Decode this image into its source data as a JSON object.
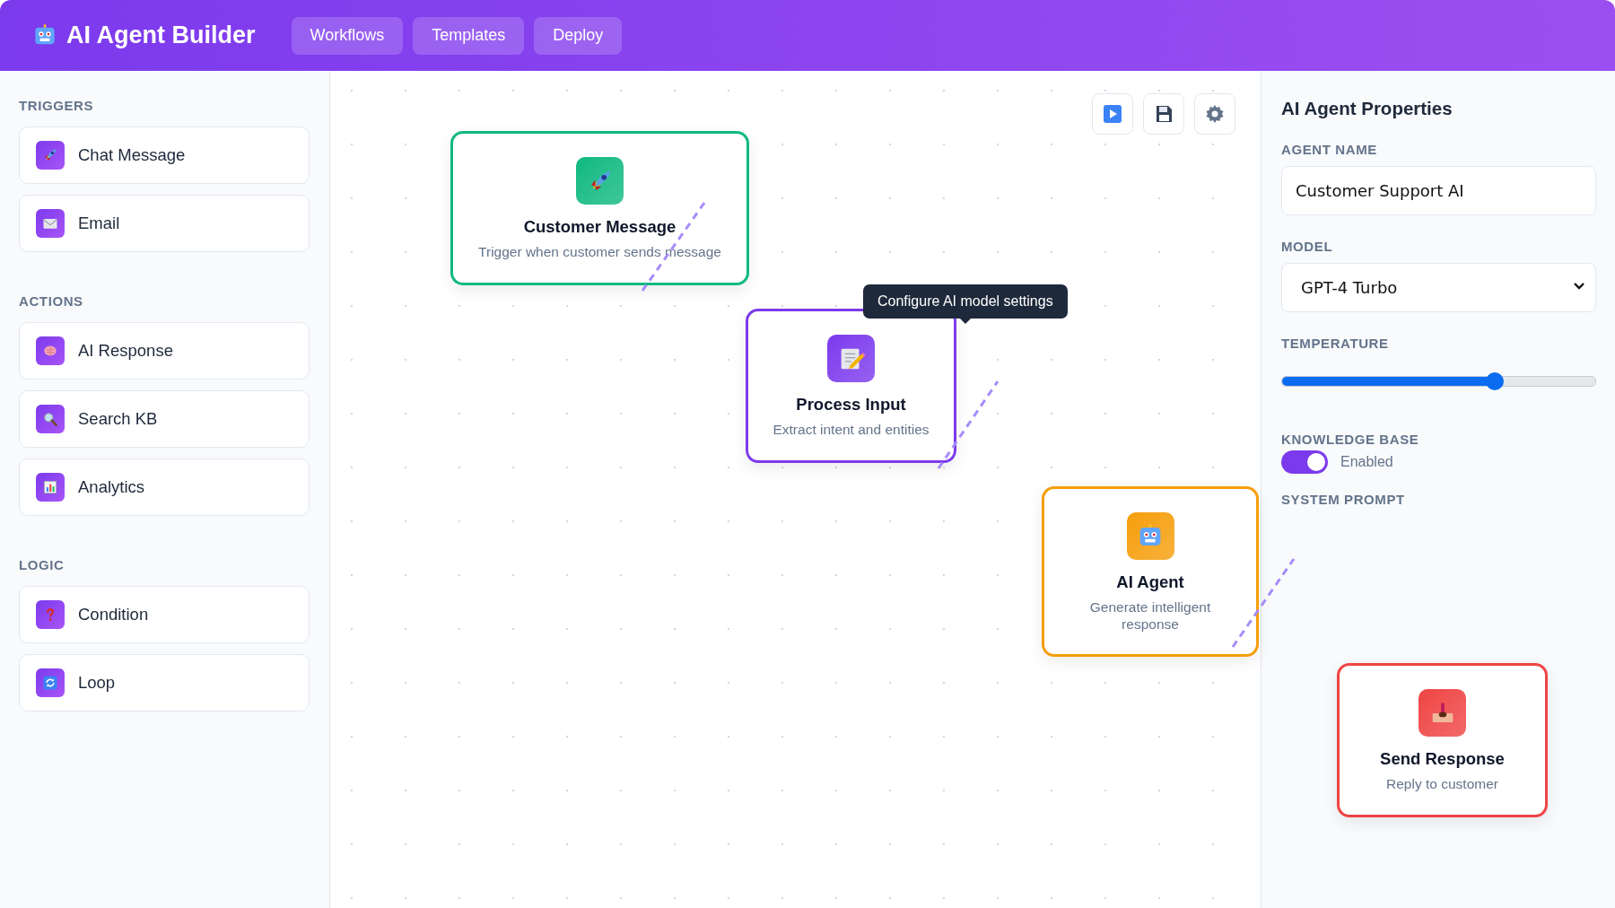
{
  "header": {
    "title": "AI Agent Builder",
    "nav": [
      {
        "label": "Workflows"
      },
      {
        "label": "Templates"
      },
      {
        "label": "Deploy"
      }
    ]
  },
  "sidebar": {
    "sections": [
      {
        "heading": "TRIGGERS",
        "items": [
          {
            "label": "Chat Message"
          },
          {
            "label": "Email"
          }
        ]
      },
      {
        "heading": "ACTIONS",
        "items": [
          {
            "label": "AI Response"
          },
          {
            "label": "Search KB"
          },
          {
            "label": "Analytics"
          }
        ]
      },
      {
        "heading": "LOGIC",
        "items": [
          {
            "label": "Condition"
          },
          {
            "label": "Loop"
          }
        ]
      }
    ]
  },
  "canvas": {
    "nodes": [
      {
        "title": "Customer Message",
        "description": "Trigger when customer sends message",
        "color": "#10b981"
      },
      {
        "title": "Process Input",
        "description": "Extract intent and entities",
        "color": "#7c3aed"
      },
      {
        "title": "AI Agent",
        "description": "Generate intelligent response",
        "color": "#f59e0b"
      },
      {
        "title": "Send Response",
        "description": "Reply to customer",
        "color": "#ef4444"
      }
    ],
    "tooltip": "Configure AI model settings"
  },
  "properties": {
    "title": "AI Agent Properties",
    "fields": [
      {
        "kind": "text",
        "label": "AGENT NAME",
        "value": "Customer Support AI"
      },
      {
        "kind": "select",
        "label": "MODEL",
        "value": "GPT-4 Turbo"
      },
      {
        "kind": "slider",
        "label": "TEMPERATURE",
        "level": 0.68
      },
      {
        "kind": "toggle",
        "label": "KNOWLEDGE BASE",
        "on": true,
        "text": "Enabled"
      },
      {
        "kind": "heading",
        "label": "SYSTEM PROMPT"
      }
    ]
  }
}
